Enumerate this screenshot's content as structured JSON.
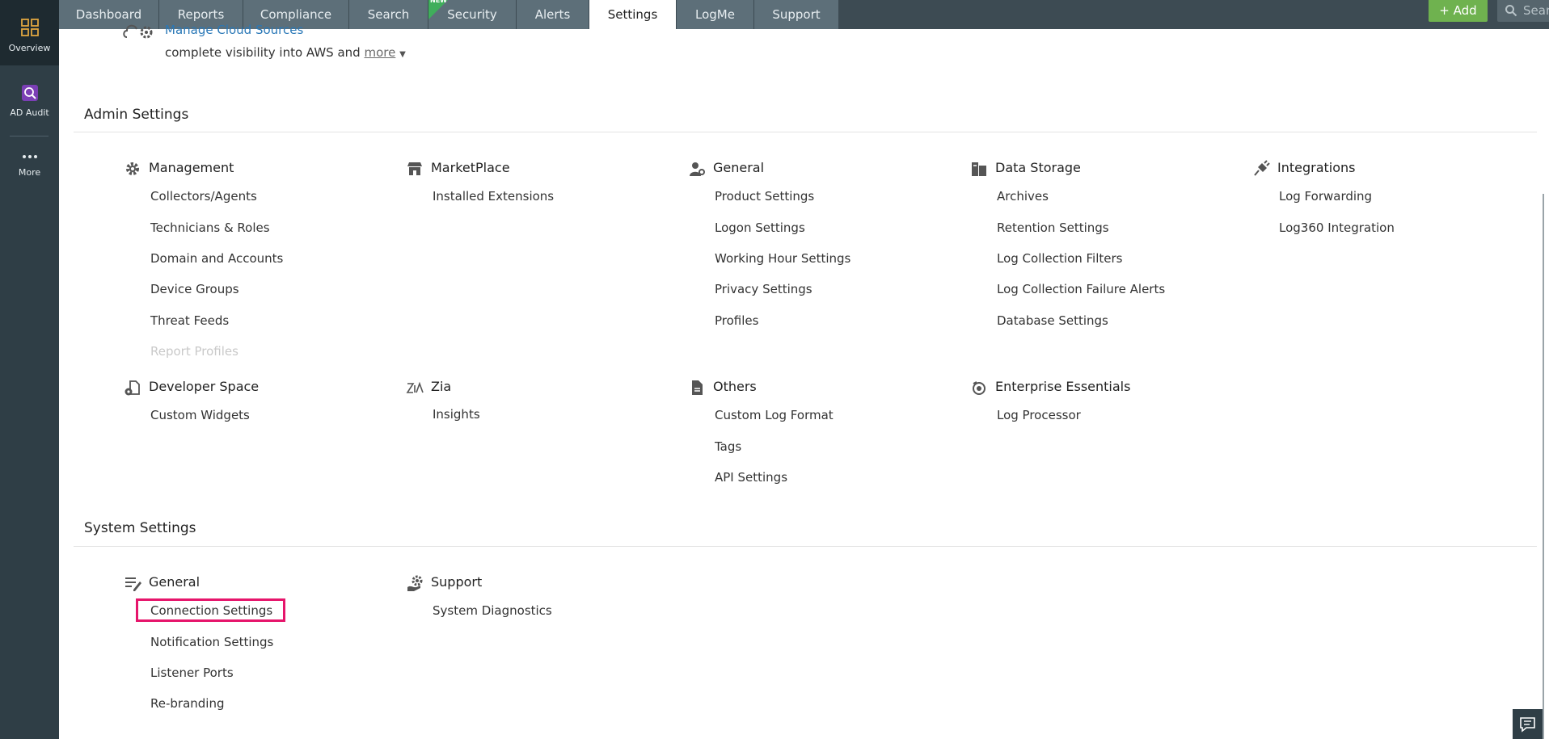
{
  "sidebar": {
    "items": [
      {
        "label": "Overview",
        "icon": "grid-icon"
      },
      {
        "label": "AD Audit",
        "icon": "ad-audit-icon"
      },
      {
        "label": "More",
        "icon": "more-dots-icon"
      }
    ]
  },
  "nav": {
    "tabs": [
      {
        "label": "Dashboard"
      },
      {
        "label": "Reports"
      },
      {
        "label": "Compliance"
      },
      {
        "label": "Search"
      },
      {
        "label": "Security",
        "badge": "NEW"
      },
      {
        "label": "Alerts"
      },
      {
        "label": "Settings",
        "active": true
      },
      {
        "label": "LogMe"
      },
      {
        "label": "Support"
      }
    ],
    "add_label": "+ Add",
    "search_placeholder": "Search"
  },
  "cloud": {
    "title": "Manage Cloud Sources",
    "description": "complete visibility into AWS and",
    "more_label": "more"
  },
  "admin": {
    "title": "Admin Settings",
    "groups": [
      {
        "title": "Management",
        "icon": "gear-icon",
        "items": [
          "Collectors/Agents",
          "Technicians & Roles",
          "Domain and Accounts",
          "Device Groups",
          "Threat Feeds",
          "Report Profiles"
        ]
      },
      {
        "title": "MarketPlace",
        "icon": "store-icon",
        "items": [
          "Installed Extensions"
        ]
      },
      {
        "title": "General",
        "icon": "user-settings-icon",
        "items": [
          "Product Settings",
          "Logon Settings",
          "Working Hour Settings",
          "Privacy Settings",
          "Profiles"
        ]
      },
      {
        "title": "Data Storage",
        "icon": "storage-icon",
        "items": [
          "Archives",
          "Retention Settings",
          "Log Collection Filters",
          "Log Collection Failure Alerts",
          "Database Settings"
        ]
      },
      {
        "title": "Integrations",
        "icon": "plug-icon",
        "items": [
          "Log Forwarding",
          "Log360 Integration"
        ]
      },
      {
        "title": "Developer Space",
        "icon": "developer-icon",
        "items": [
          "Custom Widgets"
        ]
      },
      {
        "title": "Zia",
        "icon": "zia-icon",
        "items": [
          "Insights"
        ]
      },
      {
        "title": "Others",
        "icon": "document-icon",
        "items": [
          "Custom Log Format",
          "Tags",
          "API Settings"
        ]
      },
      {
        "title": "Enterprise Essentials",
        "icon": "enterprise-icon",
        "items": [
          "Log Processor"
        ]
      }
    ]
  },
  "system": {
    "title": "System Settings",
    "groups": [
      {
        "title": "General",
        "icon": "edit-settings-icon",
        "items": [
          "Connection Settings",
          "Notification Settings",
          "Listener Ports",
          "Re-branding"
        ]
      },
      {
        "title": "Support",
        "icon": "support-gear-icon",
        "items": [
          "System Diagnostics"
        ]
      }
    ]
  }
}
